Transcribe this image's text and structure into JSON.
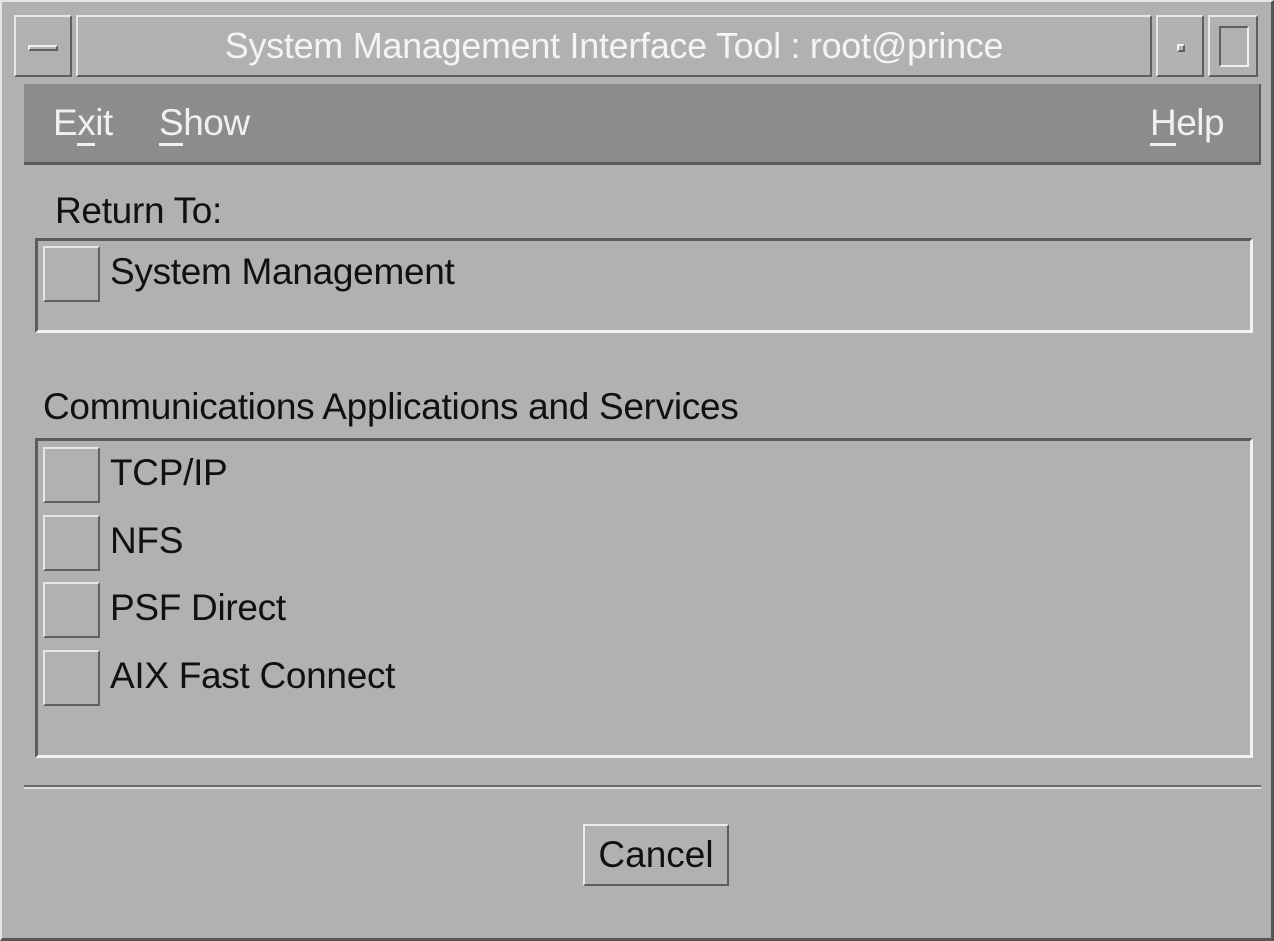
{
  "window": {
    "title": "System Management Interface Tool : root@prince"
  },
  "menubar": {
    "exit": {
      "label": "Exit",
      "mnemonic_pre": "E",
      "mnemonic": "x",
      "mnemonic_post": "it"
    },
    "show": {
      "label": "Show",
      "mnemonic_pre": "",
      "mnemonic": "S",
      "mnemonic_post": "how"
    },
    "help": {
      "label": "Help",
      "mnemonic_pre": "",
      "mnemonic": "H",
      "mnemonic_post": "elp"
    }
  },
  "return_to": {
    "label": "Return To:",
    "items": [
      {
        "label": "System Management"
      }
    ]
  },
  "section": {
    "label": "Communications Applications and Services",
    "items": [
      {
        "label": "TCP/IP"
      },
      {
        "label": "NFS"
      },
      {
        "label": "PSF Direct"
      },
      {
        "label": "AIX Fast Connect"
      }
    ]
  },
  "footer": {
    "cancel_label": "Cancel"
  }
}
